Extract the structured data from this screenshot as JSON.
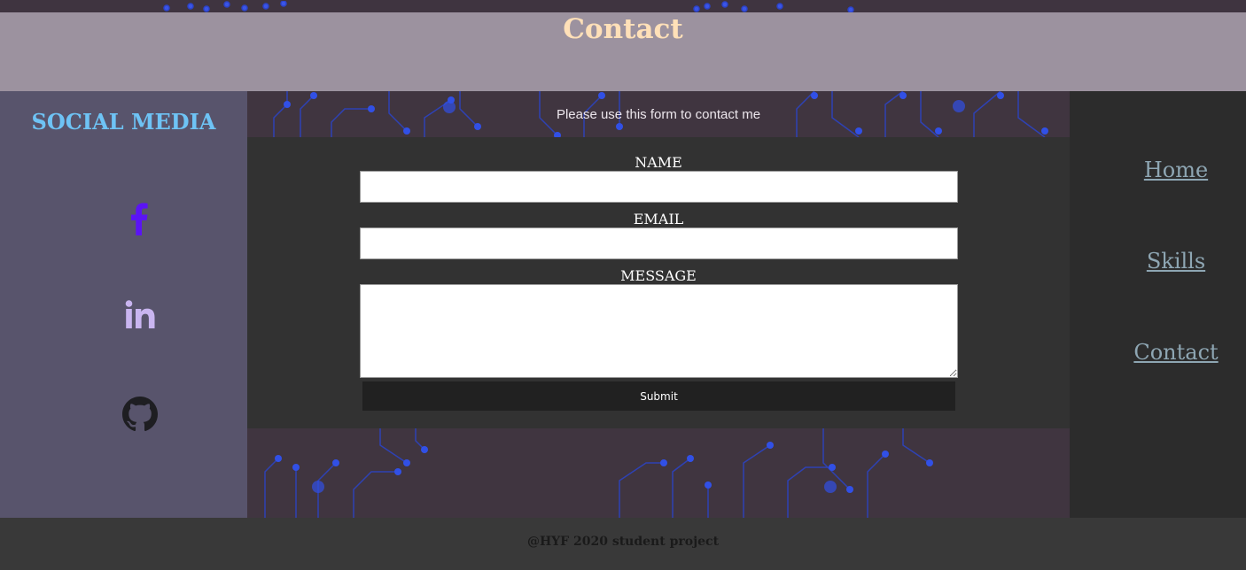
{
  "header": {
    "title": "Contact"
  },
  "social": {
    "heading": "SOCIAL MEDIA",
    "links": [
      {
        "icon": "facebook-icon",
        "color": "#5b14f5"
      },
      {
        "icon": "linkedin-icon",
        "color": "#c9b5f0"
      },
      {
        "icon": "github-icon",
        "color": "#1e1e22"
      }
    ]
  },
  "main": {
    "intro": "Please use this form to contact me",
    "form": {
      "name_label": "NAME",
      "name_value": "",
      "email_label": "EMAIL",
      "email_value": "",
      "message_label": "MESSAGE",
      "message_value": "",
      "submit_label": "Submit"
    }
  },
  "nav": {
    "items": [
      {
        "label": "Home"
      },
      {
        "label": "Skills"
      },
      {
        "label": "Contact"
      }
    ]
  },
  "footer": {
    "text": "@HYF 2020 student project"
  },
  "colors": {
    "banner_bg": "#9c929f",
    "title": "#ffe0b8",
    "social_heading": "#6ec3f5",
    "sidebar_bg": "#58546c",
    "form_bg": "#323232",
    "nav_link": "#8ea6b3",
    "circuit": "#2f45d8"
  }
}
